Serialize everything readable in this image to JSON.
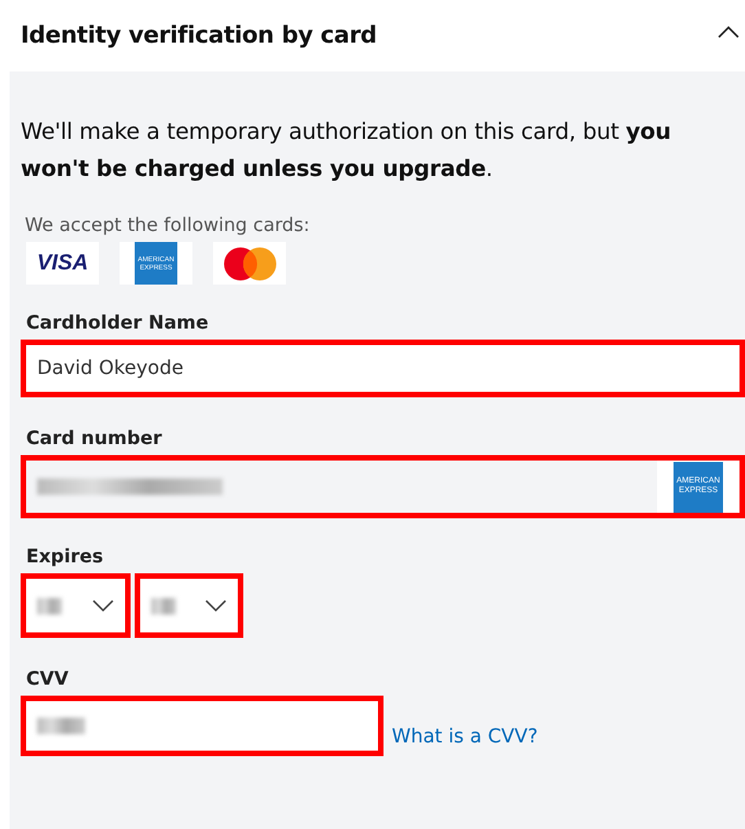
{
  "section": {
    "title": "Identity verification by card",
    "expanded": true
  },
  "notice": "We'll make a temporary authorization on this card, but **you won't be charged unless you upgrade**.",
  "accepted_cards": {
    "label": "We accept the following cards:",
    "cards": [
      {
        "kind": "visa",
        "text": "VISA"
      },
      {
        "kind": "amex",
        "text": "AMERICAN EXPRESS"
      },
      {
        "kind": "mastercard"
      }
    ]
  },
  "cardholder_name": {
    "label": "Cardholder Name",
    "value": "David Okeyode",
    "highlighted": true
  },
  "card_number": {
    "label": "Card number",
    "value_redacted": true,
    "card_logos": [
      {
        "kind": "amex",
        "text": "AMERICAN EXPRESS"
      }
    ],
    "highlighted": true
  },
  "expires": {
    "label": "Expires",
    "selects": [
      {
        "value_redacted": true,
        "highlighted": true
      },
      {
        "value_redacted": true,
        "highlighted": true
      }
    ]
  },
  "cvv": {
    "label": "CVV",
    "value_redacted": true,
    "highlighted": true,
    "help_link": "What is a CVV?"
  }
}
